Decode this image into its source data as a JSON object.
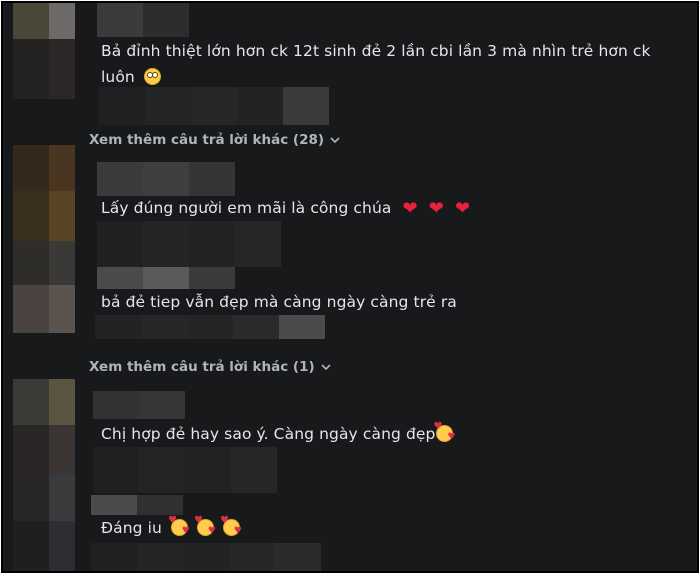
{
  "comments": [
    {
      "text": "Bả đỉnh thiệt lớn hơn ck 12t sinh đẻ 2 lần cbi lần 3 mà nhìn trẻ hơn ck luôn",
      "emoji": "flushed-face-icon"
    },
    {
      "text": "Lấy đúng người em mãi là công chúa",
      "emoji": "red-heart-icon"
    },
    {
      "text": "bả đẻ tiep vẫn đẹp mà càng ngày càng trẻ ra",
      "emoji": ""
    },
    {
      "text": "Chị hợp đẻ hay sao ý. Càng ngày càng đẹp",
      "emoji": "smiling-face-with-hearts-icon"
    },
    {
      "text": "Đáng iu",
      "emoji": "smiling-face-with-hearts-icon"
    }
  ],
  "more_replies": [
    {
      "label": "Xem thêm câu trả lời khác (28)"
    },
    {
      "label": "Xem thêm câu trả lời khác (1)"
    }
  ],
  "colors": {
    "background": "#18191a",
    "text": "#e4e6eb",
    "secondary_text": "#b0b3b8",
    "heart": "#e8213d"
  }
}
